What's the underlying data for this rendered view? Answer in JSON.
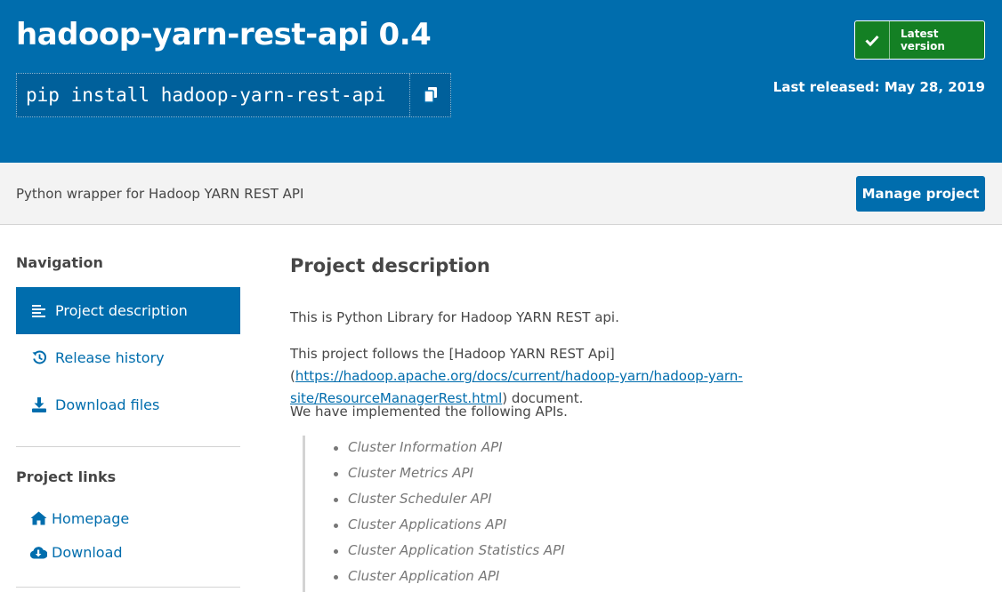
{
  "header": {
    "package_title": "hadoop-yarn-rest-api 0.4",
    "pip_command": "pip install hadoop-yarn-rest-api",
    "latest_badge": "Latest version",
    "last_released": "Last released: May 28, 2019"
  },
  "summary": {
    "text": "Python wrapper for Hadoop YARN REST API",
    "manage_button": "Manage project"
  },
  "sidebar": {
    "navigation_heading": "Navigation",
    "nav_items": [
      {
        "label": "Project description",
        "icon": "align-left-icon",
        "active": true
      },
      {
        "label": "Release history",
        "icon": "history-icon",
        "active": false
      },
      {
        "label": "Download files",
        "icon": "download-icon",
        "active": false
      }
    ],
    "links_heading": "Project links",
    "links": [
      {
        "label": "Homepage",
        "icon": "home-icon"
      },
      {
        "label": "Download",
        "icon": "cloud-download-icon"
      }
    ]
  },
  "main": {
    "heading": "Project description",
    "para1": "This is Python Library for Hadoop YARN REST api.",
    "para2_before": "This project follows the [Hadoop YARN REST Api](",
    "para2_link": "https://hadoop.apache.org/docs/current/hadoop-yarn/hadoop-yarn-site/ResourceManagerRest.html",
    "para2_after": ") document.",
    "para3": "We have implemented the following APIs.",
    "apis": [
      "Cluster Information API",
      "Cluster Metrics API",
      "Cluster Scheduler API",
      "Cluster Applications API",
      "Cluster Application Statistics API",
      "Cluster Application API"
    ]
  },
  "colors": {
    "brand_blue": "#006dad",
    "badge_green": "#148024"
  }
}
